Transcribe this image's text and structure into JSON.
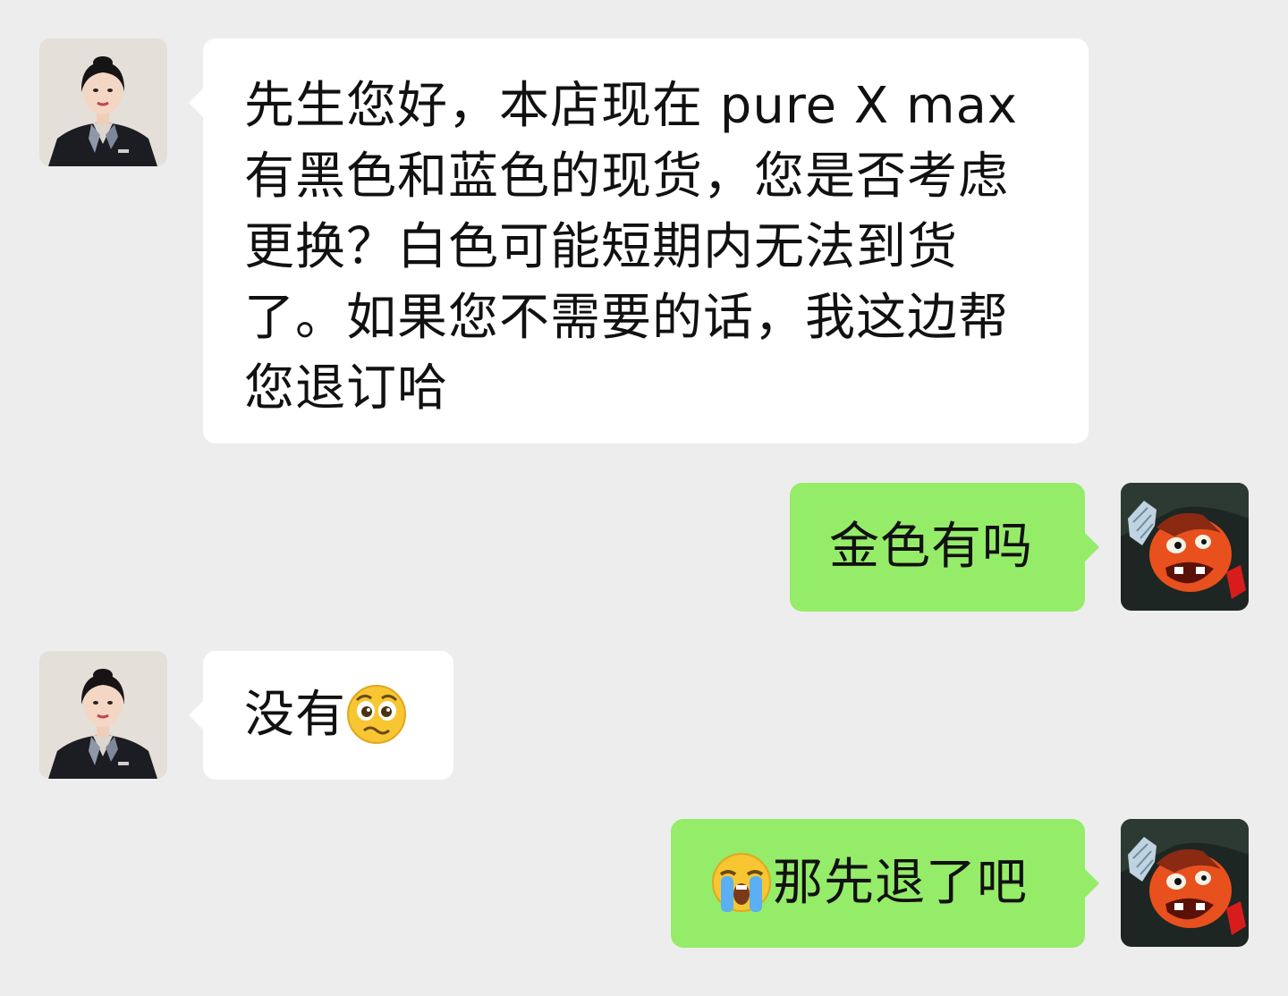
{
  "messages": [
    {
      "sender": "merchant",
      "text": "先生您好，本店现在 pure X max 有黑色和蓝色的现货，您是否考虑更换？白色可能短期内无法到货了。如果您不需要的话，我这边帮您退订哈"
    },
    {
      "sender": "customer",
      "text": "金色有吗"
    },
    {
      "sender": "merchant",
      "text": "没有",
      "emoji_after": "pleading-face-emoji"
    },
    {
      "sender": "customer",
      "text": "那先退了吧",
      "emoji_before": "loudly-crying-face-emoji"
    }
  ],
  "colors": {
    "background": "#ededed",
    "incoming_bubble": "#ffffff",
    "outgoing_bubble": "#95ec69",
    "text": "#111111"
  },
  "icons": {
    "merchant_avatar": "agent-avatar-photo",
    "customer_avatar": "cartoon-avatar"
  }
}
